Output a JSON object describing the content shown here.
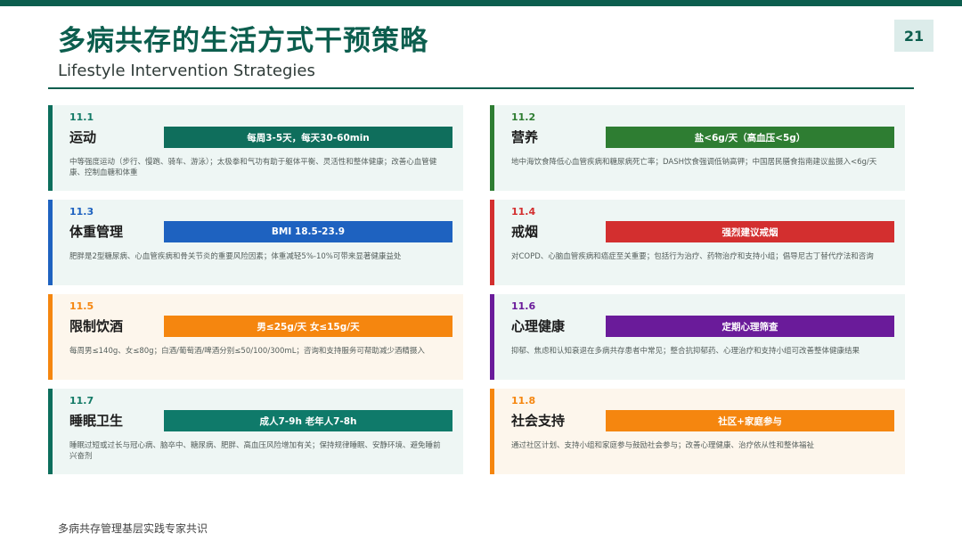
{
  "page": {
    "title": "多病共存的生活方式干预策略",
    "subtitle": "Lifestyle Intervention Strategies",
    "page_number": "21",
    "footer": "多病共存管理基层实践专家共识"
  },
  "colors": {
    "brand": "#0c5e4e",
    "teal": "#137a66",
    "green": "#2e7d32",
    "blue": "#1e62c0",
    "red": "#d32f2f",
    "orange": "#f5860f",
    "purple": "#6a1b9a"
  },
  "cards": [
    {
      "num": "11.1",
      "name": "运动",
      "badge": "每周3-5天，每天30-60min",
      "desc": "中等强度运动（步行、慢跑、骑车、游泳）；太极拳和气功有助于躯体平衡、灵活性和整体健康；改善心血管健康、控制血糖和体重"
    },
    {
      "num": "11.2",
      "name": "营养",
      "badge": "盐<6g/天（高血压<5g）",
      "desc": "地中海饮食降低心血管疾病和糖尿病死亡率；DASH饮食强调低钠高钾；中国居民膳食指南建议盐摄入<6g/天"
    },
    {
      "num": "11.3",
      "name": "体重管理",
      "badge": "BMI 18.5-23.9",
      "desc": "肥胖是2型糖尿病、心血管疾病和骨关节炎的重要风险因素；体重减轻5%-10%可带来显著健康益处"
    },
    {
      "num": "11.4",
      "name": "戒烟",
      "badge": "强烈建议戒烟",
      "desc": "对COPD、心脑血管疾病和癌症至关重要；包括行为治疗、药物治疗和支持小组；倡导尼古丁替代疗法和咨询"
    },
    {
      "num": "11.5",
      "name": "限制饮酒",
      "badge": "男≤25g/天 女≤15g/天",
      "desc": "每周男≤140g、女≤80g；白酒/葡萄酒/啤酒分别≤50/100/300mL；咨询和支持服务可帮助减少酒精摄入"
    },
    {
      "num": "11.6",
      "name": "心理健康",
      "badge": "定期心理筛查",
      "desc": "抑郁、焦虑和认知衰退在多病共存患者中常见；整合抗抑郁药、心理治疗和支持小组可改善整体健康结果"
    },
    {
      "num": "11.7",
      "name": "睡眠卫生",
      "badge": "成人7-9h 老年人7-8h",
      "desc": "睡眠过短或过长与冠心病、脑卒中、糖尿病、肥胖、高血压风险增加有关；保持规律睡眠、安静环境、避免睡前兴奋剂"
    },
    {
      "num": "11.8",
      "name": "社会支持",
      "badge": "社区+家庭参与",
      "desc": "通过社区计划、支持小组和家庭参与鼓励社会参与；改善心理健康、治疗依从性和整体福祉"
    }
  ]
}
